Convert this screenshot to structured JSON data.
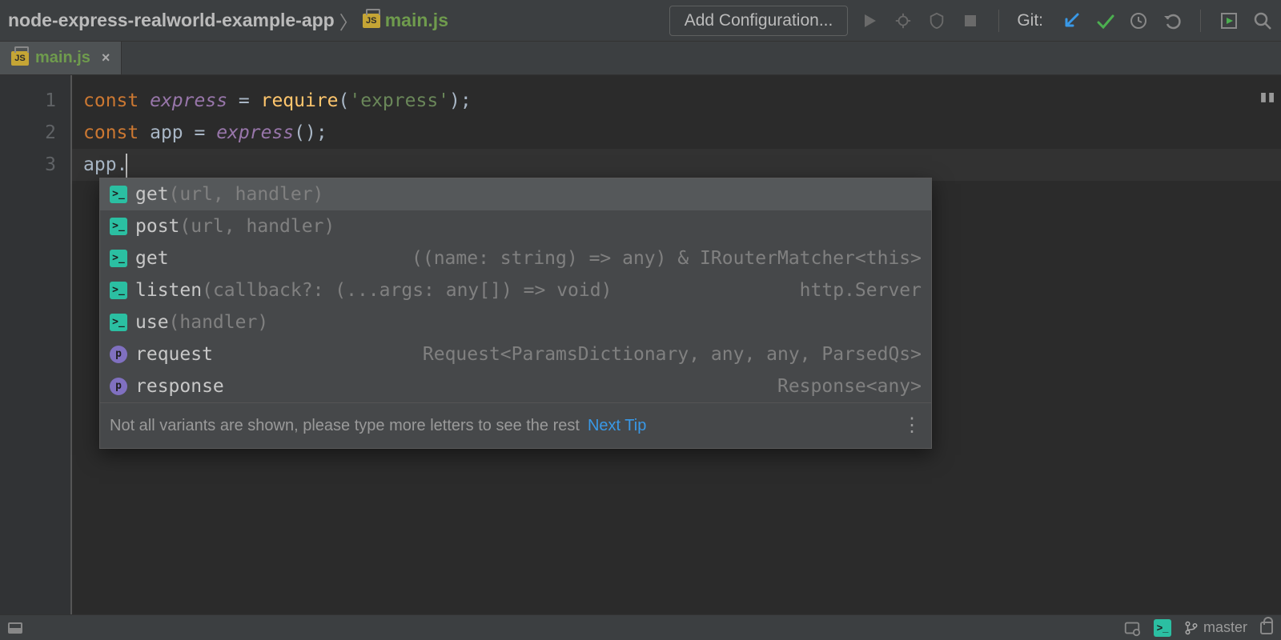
{
  "navbar": {
    "project": "node-express-realworld-example-app",
    "file": "main.js",
    "add_config": "Add Configuration...",
    "git_label": "Git:"
  },
  "tab": {
    "file": "main.js"
  },
  "gutter": [
    "1",
    "2",
    "3"
  ],
  "code": {
    "l1": {
      "kw": "const",
      "ident": "express",
      "eq": " = ",
      "fn": "require",
      "open": "(",
      "str": "'express'",
      "close": ");"
    },
    "l2": {
      "kw": "const",
      "ident": "app",
      "eq": " = ",
      "call": "express",
      "tail": "();"
    },
    "l3": {
      "obj": "app",
      "dot": "."
    }
  },
  "popup": {
    "items": [
      {
        "icon": "m",
        "label": "get",
        "sig": "(url, handler)",
        "type": ""
      },
      {
        "icon": "m",
        "label": "post",
        "sig": "(url, handler)",
        "type": ""
      },
      {
        "icon": "m",
        "label": "get",
        "sig": "",
        "type": "((name: string) => any) & IRouterMatcher<this>"
      },
      {
        "icon": "m",
        "label": "listen",
        "sig": "(callback?: (...args: any[]) => void)",
        "type": "http.Server"
      },
      {
        "icon": "m",
        "label": "use",
        "sig": "(handler)",
        "type": ""
      },
      {
        "icon": "p",
        "label": "request",
        "sig": "",
        "type": "Request<ParamsDictionary, any, any, ParsedQs>"
      },
      {
        "icon": "p",
        "label": "response",
        "sig": "",
        "type": "Response<any>"
      }
    ],
    "footer_text": "Not all variants are shown, please type more letters to see the rest",
    "footer_link": "Next Tip"
  },
  "status": {
    "branch": "master"
  }
}
